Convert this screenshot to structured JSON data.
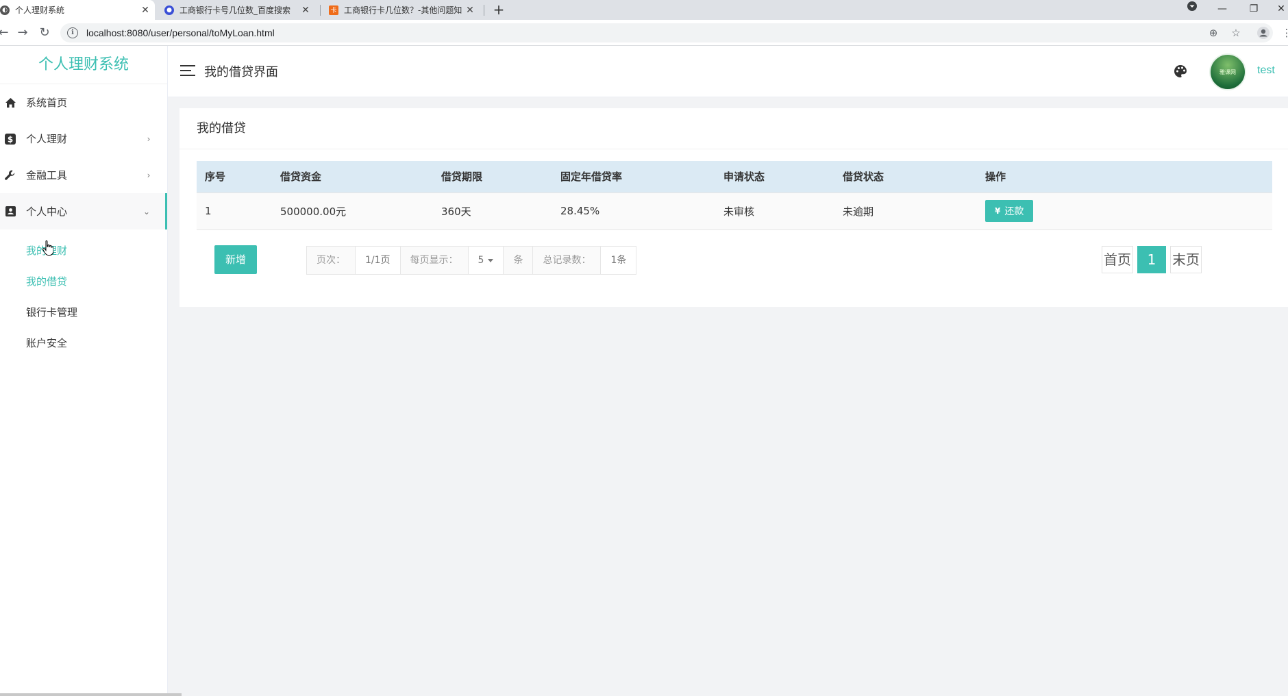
{
  "browser": {
    "tabs": [
      {
        "title": "个人理财系统",
        "close": "✕",
        "icon": "globe-icon",
        "active": true
      },
      {
        "title": "工商银行卡号几位数_百度搜索",
        "close": "✕",
        "icon": "baidu-paw-icon",
        "active": false
      },
      {
        "title": "工商银行卡几位数？-其他问题知",
        "close": "✕",
        "icon": "zhidao-icon",
        "active": false
      }
    ],
    "new_tab": "+",
    "url": "localhost:8080/user/personal/toMyLoan.html"
  },
  "sidebar": {
    "logo": "个人理财系统",
    "items": [
      {
        "label": "系统首页",
        "icon": "home-icon"
      },
      {
        "label": "个人理财",
        "icon": "dollar-icon",
        "arrow": "›"
      },
      {
        "label": "金融工具",
        "icon": "wrench-icon",
        "arrow": "›"
      },
      {
        "label": "个人中心",
        "icon": "contact-card-icon",
        "arrow": "⌄"
      }
    ],
    "submenu": [
      {
        "label": "我的理财"
      },
      {
        "label": "我的借贷"
      },
      {
        "label": "银行卡管理"
      },
      {
        "label": "账户安全"
      }
    ]
  },
  "header": {
    "title": "我的借贷界面",
    "username": "test",
    "avatar_text": "雅课网"
  },
  "card": {
    "title": "我的借贷",
    "columns": [
      "序号",
      "借贷资金",
      "借贷期限",
      "固定年借贷率",
      "申请状态",
      "借贷状态",
      "操作"
    ],
    "rows": [
      {
        "index": "1",
        "amount": "500000.00元",
        "term": "360天",
        "rate": "28.45%",
        "apply_status": "未审核",
        "loan_status": "未逾期",
        "action": "还款",
        "action_icon": "¥"
      }
    ],
    "add_button": "新增",
    "pager": {
      "page_label": "页次：",
      "page_value": "1/1页",
      "per_page_label": "每页显示：",
      "per_page_value": "5",
      "unit": "条",
      "total_label": "总记录数：",
      "total_value": "1条"
    },
    "page_nav": {
      "first": "首页",
      "current": "1",
      "last": "末页"
    }
  },
  "colors": {
    "accent": "#3cbfb2",
    "table_header": "#dbeaf4"
  }
}
